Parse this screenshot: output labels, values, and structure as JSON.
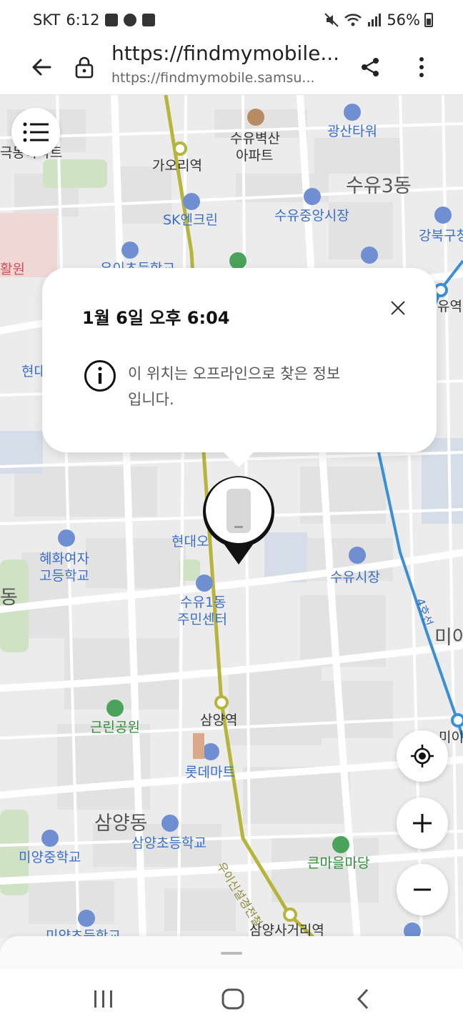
{
  "status_bar": {
    "carrier": "SKT",
    "time": "6:12",
    "battery": "56%"
  },
  "browser": {
    "url_title": "https://findmymobile....",
    "url_sub": "https://findmymobile.samsu..."
  },
  "map": {
    "labels": [
      "수유벽산",
      "아파트",
      "광산타워",
      "극동아파트",
      "가오리역",
      "수유3동",
      "SK엔크린",
      "수유중앙시장",
      "강북구청",
      "활원",
      "유역",
      "현대",
      "혜화여자",
      "고등학교",
      "현대오",
      "수유1동",
      "주민센터",
      "수유시장",
      "4호선",
      "동",
      "미아",
      "근린공원",
      "삼양역",
      "롯데마트",
      "미이",
      "삼양동",
      "삼양초등학교",
      "미양중학교",
      "큰마을마당",
      "우이신설경전철",
      "삼양사거리역",
      "미양초등학교",
      "우이초등학교"
    ]
  },
  "popup": {
    "title": "1월 6일 오후 6:04",
    "message": "이 위치는 오프라인으로 찾은 정보입니다."
  },
  "colors": {
    "line_yellow": "#b6b53a",
    "line_blue": "#3b8fd4",
    "map_bg": "#ececec"
  }
}
